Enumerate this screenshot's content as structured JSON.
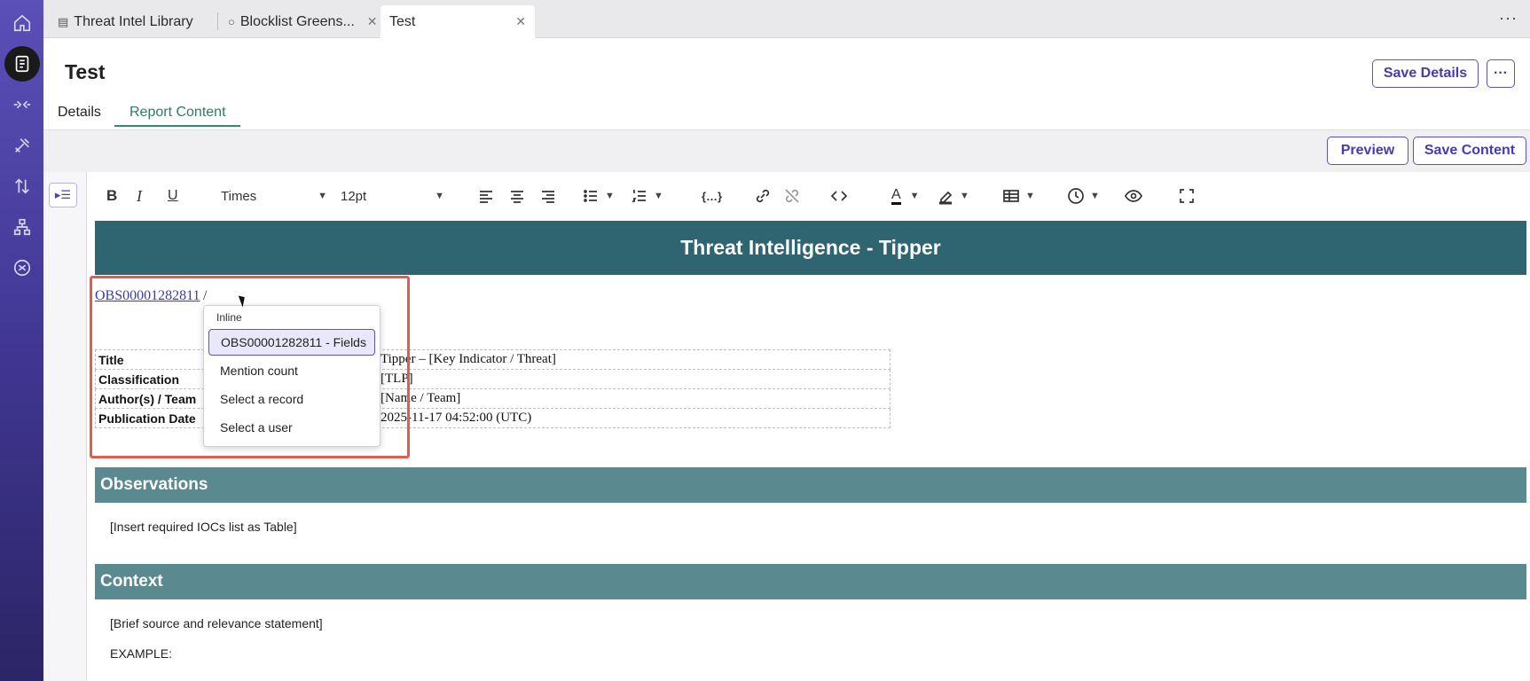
{
  "rail": {
    "icons": [
      "home-icon",
      "library-icon",
      "connector-icon",
      "tools-icon",
      "transfer-icon",
      "hierarchy-icon",
      "shuffle-icon"
    ]
  },
  "tabs": [
    {
      "label": "Threat Intel Library",
      "icon": "library-icon",
      "closable": false,
      "active": false
    },
    {
      "label": "Blocklist Greens...",
      "icon": "circle-icon",
      "closable": true,
      "active": false
    },
    {
      "label": "Test",
      "icon": "",
      "closable": true,
      "active": true
    }
  ],
  "tabbar_more": "···",
  "page": {
    "title": "Test",
    "save_details_label": "Save Details",
    "more_label": "···",
    "subtabs": [
      "Details",
      "Report Content"
    ],
    "active_subtab": "Report Content"
  },
  "content_bar": {
    "preview_label": "Preview",
    "save_content_label": "Save Content"
  },
  "editor_toolbar": {
    "font_family": "Times",
    "font_size": "12pt",
    "text_color": "#111111",
    "highlight_color": "#111111"
  },
  "document": {
    "banner": "Threat Intelligence - Tipper",
    "obs_link": "OBS00001282811",
    "slash": "/",
    "meta_rows": [
      {
        "key": "Title",
        "value": "Tipper – [Key Indicator / Threat]"
      },
      {
        "key": "Classification",
        "value": "[TLP]"
      },
      {
        "key": "Author(s) / Team",
        "value": "[Name / Team]"
      },
      {
        "key": "Publication Date",
        "value": "2025-11-17 04:52:00 (UTC)"
      }
    ],
    "sections": [
      {
        "title": "Observations",
        "paragraphs": [
          "[Insert required IOCs list as Table]"
        ]
      },
      {
        "title": "Context",
        "paragraphs": [
          "[Brief source and relevance statement]",
          "EXAMPLE:"
        ]
      }
    ]
  },
  "popup": {
    "header": "Inline",
    "items": [
      "OBS00001282811 - Fields",
      "Mention count",
      "Select a record",
      "Select a user"
    ],
    "selected_index": 0
  },
  "colors": {
    "accent": "#5b52c2",
    "banner": "#2e6570",
    "section": "#5a8a8f",
    "highlight": "#e25c4f",
    "active_tab_text": "#2f7a62"
  }
}
